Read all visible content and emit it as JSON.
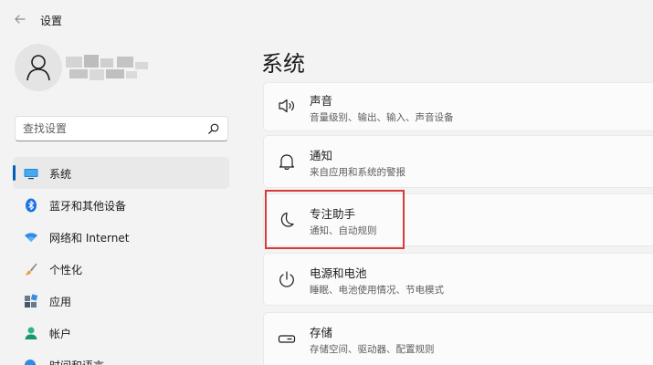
{
  "app": {
    "title": "设置"
  },
  "search": {
    "placeholder": "查找设置"
  },
  "nav": {
    "items": [
      {
        "label": "系统",
        "icon": "monitor-icon",
        "active": true
      },
      {
        "label": "蓝牙和其他设备",
        "icon": "bluetooth-icon"
      },
      {
        "label": "网络和 Internet",
        "icon": "wifi-icon"
      },
      {
        "label": "个性化",
        "icon": "brush-icon"
      },
      {
        "label": "应用",
        "icon": "apps-icon"
      },
      {
        "label": "帐户",
        "icon": "account-icon"
      },
      {
        "label": "时间和语言",
        "icon": "globe-clock-icon"
      }
    ]
  },
  "main": {
    "title": "系统",
    "cards": [
      {
        "title": "声音",
        "subtitle": "音量级别、输出、输入、声音设备",
        "icon": "speaker-icon"
      },
      {
        "title": "通知",
        "subtitle": "来自应用和系统的警报",
        "icon": "bell-icon"
      },
      {
        "title": "专注助手",
        "subtitle": "通知、自动规则",
        "icon": "moon-icon"
      },
      {
        "title": "电源和电池",
        "subtitle": "睡眠、电池使用情况、节电模式",
        "icon": "power-icon"
      },
      {
        "title": "存储",
        "subtitle": "存储空间、驱动器、配置规则",
        "icon": "drive-icon"
      }
    ]
  },
  "colors": {
    "accent": "#005fb8",
    "highlight": "#d93a3a",
    "background": "#f3f3f3"
  }
}
